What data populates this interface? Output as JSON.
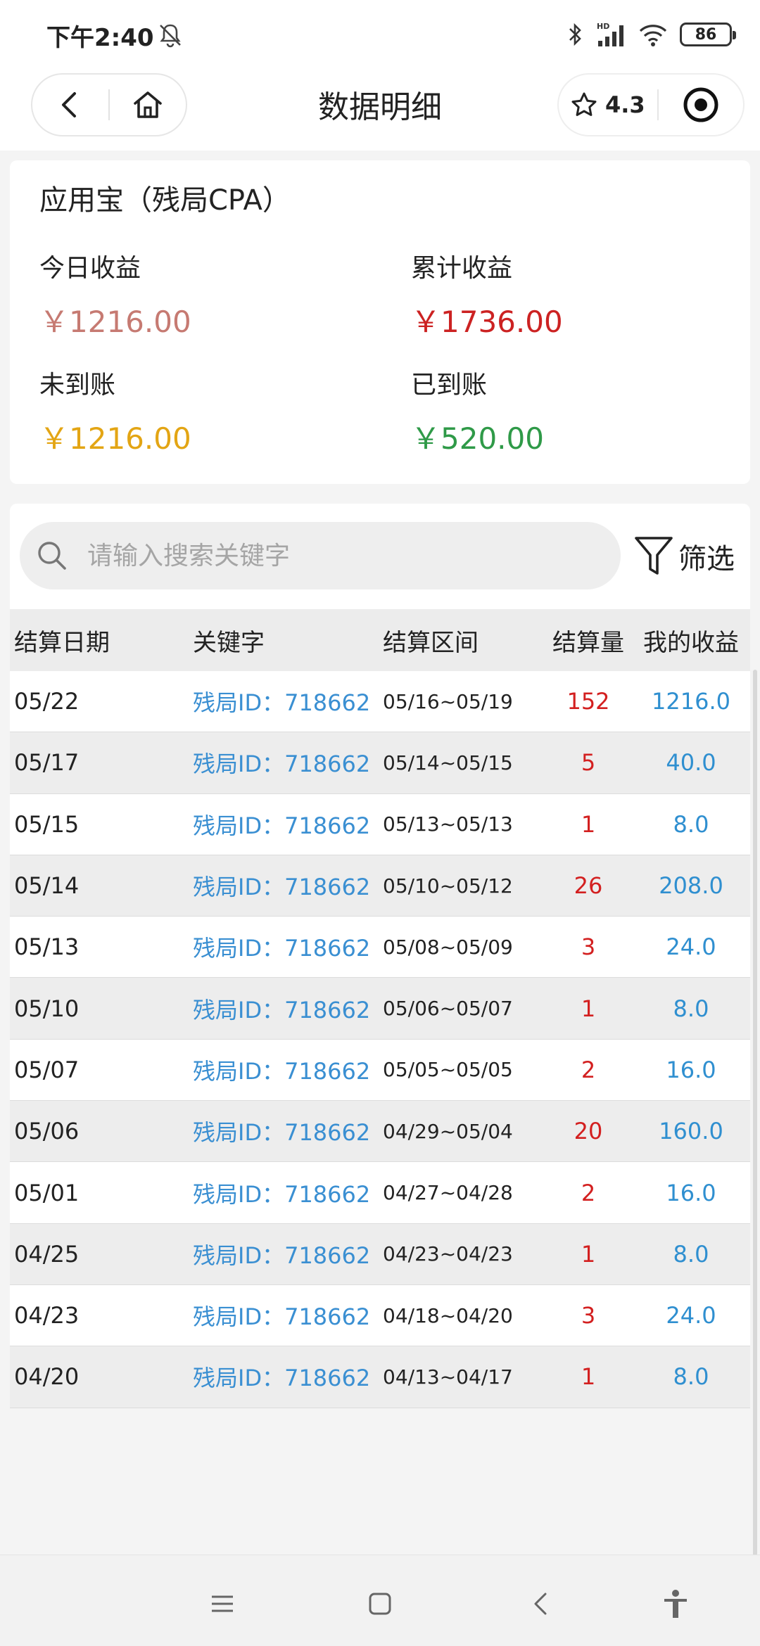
{
  "status": {
    "time": "下午2:40",
    "battery": "86",
    "network": "HD"
  },
  "nav": {
    "title": "数据明细",
    "rating": "4.3"
  },
  "summary": {
    "title": "应用宝（残局CPA）",
    "today_label": "今日收益",
    "today_value": "￥1216.00",
    "total_label": "累计收益",
    "total_value": "￥1736.00",
    "pending_label": "未到账",
    "pending_value": "￥1216.00",
    "received_label": "已到账",
    "received_value": "￥520.00",
    "colors": {
      "today": "#c67a72",
      "total": "#cc2222",
      "pending": "#e3a514",
      "received": "#2f9a48"
    }
  },
  "search": {
    "placeholder": "请输入搜索关键字",
    "value": ""
  },
  "filter": {
    "label": "筛选"
  },
  "table": {
    "headers": [
      "结算日期",
      "关键字",
      "结算区间",
      "结算量",
      "我的收益"
    ],
    "rows": [
      {
        "date": "05/22",
        "keyword": "残局ID：718662",
        "range": "05/16~05/19",
        "qty": "152",
        "income": "1216.0"
      },
      {
        "date": "05/17",
        "keyword": "残局ID：718662",
        "range": "05/14~05/15",
        "qty": "5",
        "income": "40.0"
      },
      {
        "date": "05/15",
        "keyword": "残局ID：718662",
        "range": "05/13~05/13",
        "qty": "1",
        "income": "8.0"
      },
      {
        "date": "05/14",
        "keyword": "残局ID：718662",
        "range": "05/10~05/12",
        "qty": "26",
        "income": "208.0"
      },
      {
        "date": "05/13",
        "keyword": "残局ID：718662",
        "range": "05/08~05/09",
        "qty": "3",
        "income": "24.0"
      },
      {
        "date": "05/10",
        "keyword": "残局ID：718662",
        "range": "05/06~05/07",
        "qty": "1",
        "income": "8.0"
      },
      {
        "date": "05/07",
        "keyword": "残局ID：718662",
        "range": "05/05~05/05",
        "qty": "2",
        "income": "16.0"
      },
      {
        "date": "05/06",
        "keyword": "残局ID：718662",
        "range": "04/29~05/04",
        "qty": "20",
        "income": "160.0"
      },
      {
        "date": "05/01",
        "keyword": "残局ID：718662",
        "range": "04/27~04/28",
        "qty": "2",
        "income": "16.0"
      },
      {
        "date": "04/25",
        "keyword": "残局ID：718662",
        "range": "04/23~04/23",
        "qty": "1",
        "income": "8.0"
      },
      {
        "date": "04/23",
        "keyword": "残局ID：718662",
        "range": "04/18~04/20",
        "qty": "3",
        "income": "24.0"
      },
      {
        "date": "04/20",
        "keyword": "残局ID：718662",
        "range": "04/13~04/17",
        "qty": "1",
        "income": "8.0"
      }
    ]
  },
  "icons": {
    "back": "back-arrow-icon",
    "home": "home-icon",
    "star": "star-icon",
    "target": "target-icon",
    "search": "search-icon",
    "filter": "filter-funnel-icon",
    "menu": "menu-icon",
    "square": "square-home-icon",
    "nav_back": "nav-back-icon",
    "accessibility": "accessibility-icon"
  }
}
